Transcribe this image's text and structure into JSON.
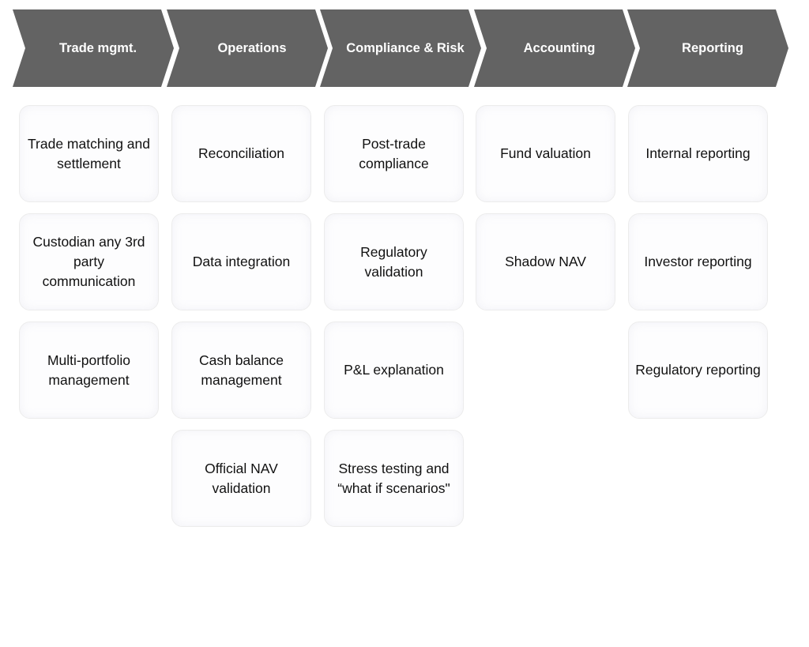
{
  "stages": [
    {
      "label": "Trade mgmt.",
      "items": [
        "Trade matching and settlement",
        "Custodian any 3rd party communication",
        "Multi-portfolio management"
      ]
    },
    {
      "label": "Operations",
      "items": [
        "Reconciliation",
        "Data integration",
        "Cash balance management",
        "Official NAV validation"
      ]
    },
    {
      "label": "Compliance & Risk",
      "items": [
        "Post-trade compliance",
        "Regulatory validation",
        "P&L explanation",
        "Stress testing and “what if scenarios\""
      ]
    },
    {
      "label": "Accounting",
      "items": [
        "Fund valuation",
        "Shadow NAV"
      ]
    },
    {
      "label": "Reporting",
      "items": [
        "Internal reporting",
        "Investor reporting",
        "Regulatory reporting"
      ]
    }
  ],
  "colors": {
    "chevron": "#636363",
    "chevron_text": "#ffffff",
    "card_border": "#ececec",
    "card_text": "#111111"
  }
}
